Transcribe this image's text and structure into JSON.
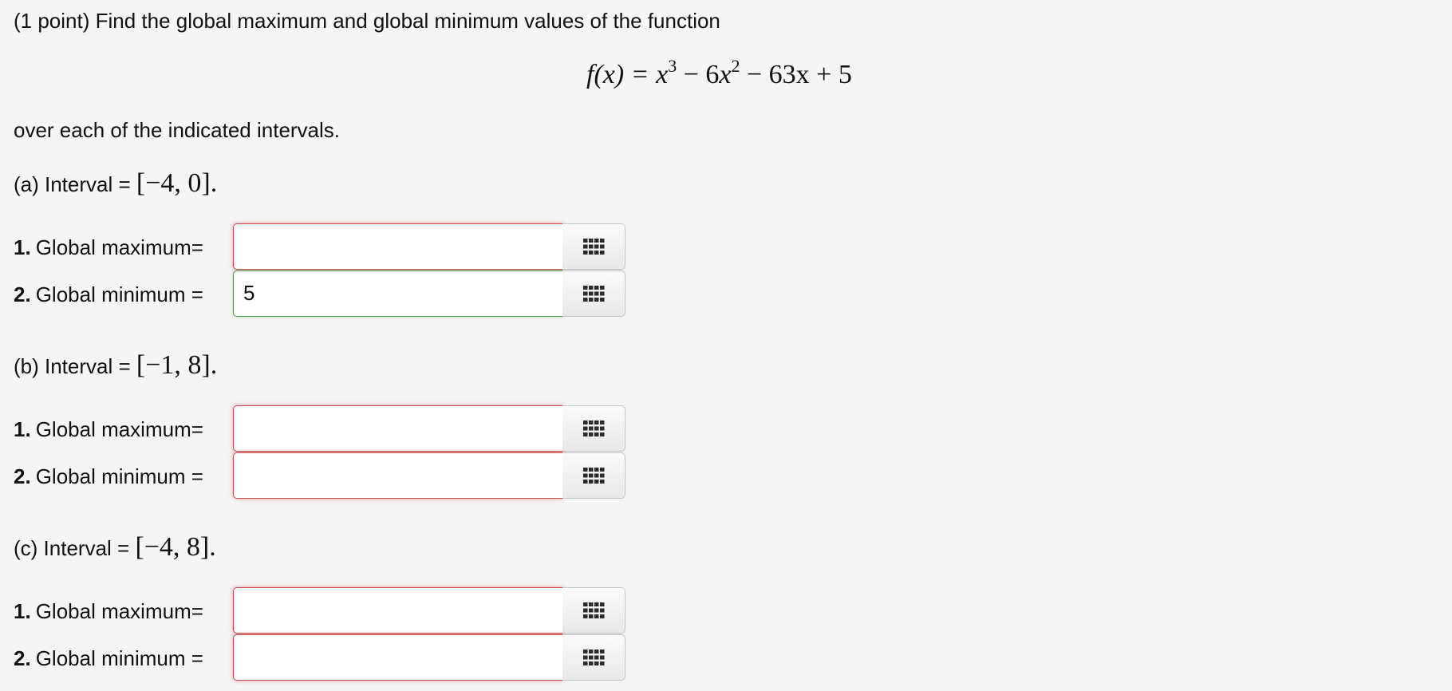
{
  "intro": "(1 point) Find the global maximum and global minimum values of the function",
  "function_display": {
    "lhs": "f(x) = ",
    "term1_base": "x",
    "term1_exp": "3",
    "minus1": " − 6",
    "term2_base": "x",
    "term2_exp": "2",
    "rest": " − 63x + 5"
  },
  "over_text": "over each of the indicated intervals.",
  "parts": [
    {
      "label": "(a) Interval = ",
      "interval": "[−4, 0].",
      "rows": [
        {
          "num": "1.",
          "label": "Global maximum=",
          "value": ""
        },
        {
          "num": "2.",
          "label": "Global minimum =",
          "value": "5"
        }
      ]
    },
    {
      "label": "(b) Interval = ",
      "interval": "[−1, 8].",
      "rows": [
        {
          "num": "1.",
          "label": "Global maximum=",
          "value": ""
        },
        {
          "num": "2.",
          "label": "Global minimum =",
          "value": ""
        }
      ]
    },
    {
      "label": "(c) Interval = ",
      "interval": "[−4, 8].",
      "rows": [
        {
          "num": "1.",
          "label": "Global maximum=",
          "value": ""
        },
        {
          "num": "2.",
          "label": "Global minimum =",
          "value": ""
        }
      ]
    }
  ],
  "icons": {
    "palette": "grid-palette-icon"
  },
  "colors": {
    "incorrect_border": "#c84a4a",
    "correct_border": "#4c9a4c"
  }
}
